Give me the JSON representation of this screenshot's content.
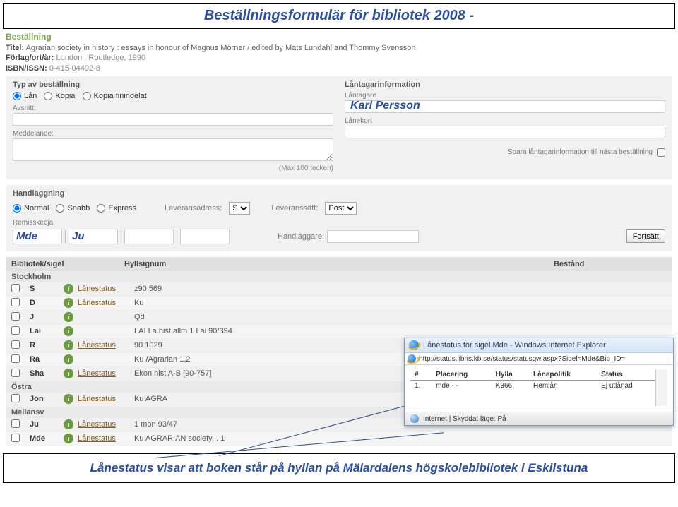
{
  "slide_title": "Beställningsformulär för bibliotek 2008 -",
  "header_section": "Beställning",
  "bib": {
    "title_label": "Titel:",
    "title": "Agrarian society in history : essays in honour of Magnus Mörner / edited by Mats Lundahl and Thommy Svensson",
    "pub_label": "Förlag/ort/år:",
    "pub": "London : Routledge, 1990",
    "isbn_label": "ISBN/ISSN:",
    "isbn": "0-415-04492-8"
  },
  "ordertype": {
    "label": "Typ av beställning",
    "options": [
      "Lån",
      "Kopia",
      "Kopia finindelat"
    ],
    "selected": 0,
    "section_label": "Avsnitt:",
    "message_label": "Meddelande:",
    "maxnote": "(Max 100 tecken)"
  },
  "borrower": {
    "label": "Låntagarinformation",
    "name_label": "Låntagare",
    "name_value": "Karl Persson",
    "card_label": "Lånekort",
    "save_label": "Spara låntagarinformation till nästa beställning"
  },
  "handling": {
    "label": "Handläggning",
    "prio": [
      "Normal",
      "Snabb",
      "Express"
    ],
    "prio_sel": 0,
    "addr_label": "Leveransadress:",
    "addr_val": "S",
    "mode_label": "Leveranssätt:",
    "mode_val": "Post",
    "remiss_label": "Remisskedja",
    "remiss_vals": [
      "Mde",
      "Ju",
      "",
      ""
    ],
    "handler_label": "Handläggare:",
    "continue": "Fortsätt"
  },
  "table": {
    "col1": "Bibliotek/sigel",
    "col2": "Hyllsignum",
    "col3": "Bestånd",
    "groups": [
      {
        "name": "Stockholm",
        "rows": [
          {
            "sigel": "S",
            "ls": true,
            "hylla": "z90 569"
          },
          {
            "sigel": "D",
            "ls": true,
            "hylla": "Ku"
          },
          {
            "sigel": "J",
            "ls": false,
            "hylla": "Qd"
          },
          {
            "sigel": "Lai",
            "ls": false,
            "hylla": "LAI La hist allm 1 Lai 90/394"
          },
          {
            "sigel": "R",
            "ls": true,
            "hylla": "90 1029"
          },
          {
            "sigel": "Ra",
            "ls": false,
            "hylla": "Ku /Agrarian 1,2"
          },
          {
            "sigel": "Sha",
            "ls": true,
            "hylla": "Ekon hist A-B [90-757]"
          }
        ]
      },
      {
        "name": "Östra",
        "rows": [
          {
            "sigel": "Jon",
            "ls": true,
            "hylla": "Ku AGRA"
          }
        ]
      },
      {
        "name": "Mellansv",
        "rows": [
          {
            "sigel": "Ju",
            "ls": true,
            "hylla": "1 mon 93/47"
          },
          {
            "sigel": "Mde",
            "ls": true,
            "hylla": "Ku AGRARIAN society... 1"
          }
        ]
      }
    ],
    "ls_label": "Lånestatus"
  },
  "popup": {
    "title": "Lånestatus för sigel Mde - Windows Internet Explorer",
    "url": "http://status.libris.kb.se/status/statusgw.aspx?Sigel=Mde&Bib_ID=",
    "th": [
      "#",
      "Placering",
      "Hylla",
      "Lånepolitik",
      "Status"
    ],
    "row": [
      "1.",
      "mde - -",
      "K366",
      "Hemlån",
      "Ej utlånad"
    ],
    "status_text": "Internet | Skyddat läge: På"
  },
  "caption": "Lånestatus visar att boken står på hyllan på Mälardalens högskolebibliotek i Eskilstuna"
}
